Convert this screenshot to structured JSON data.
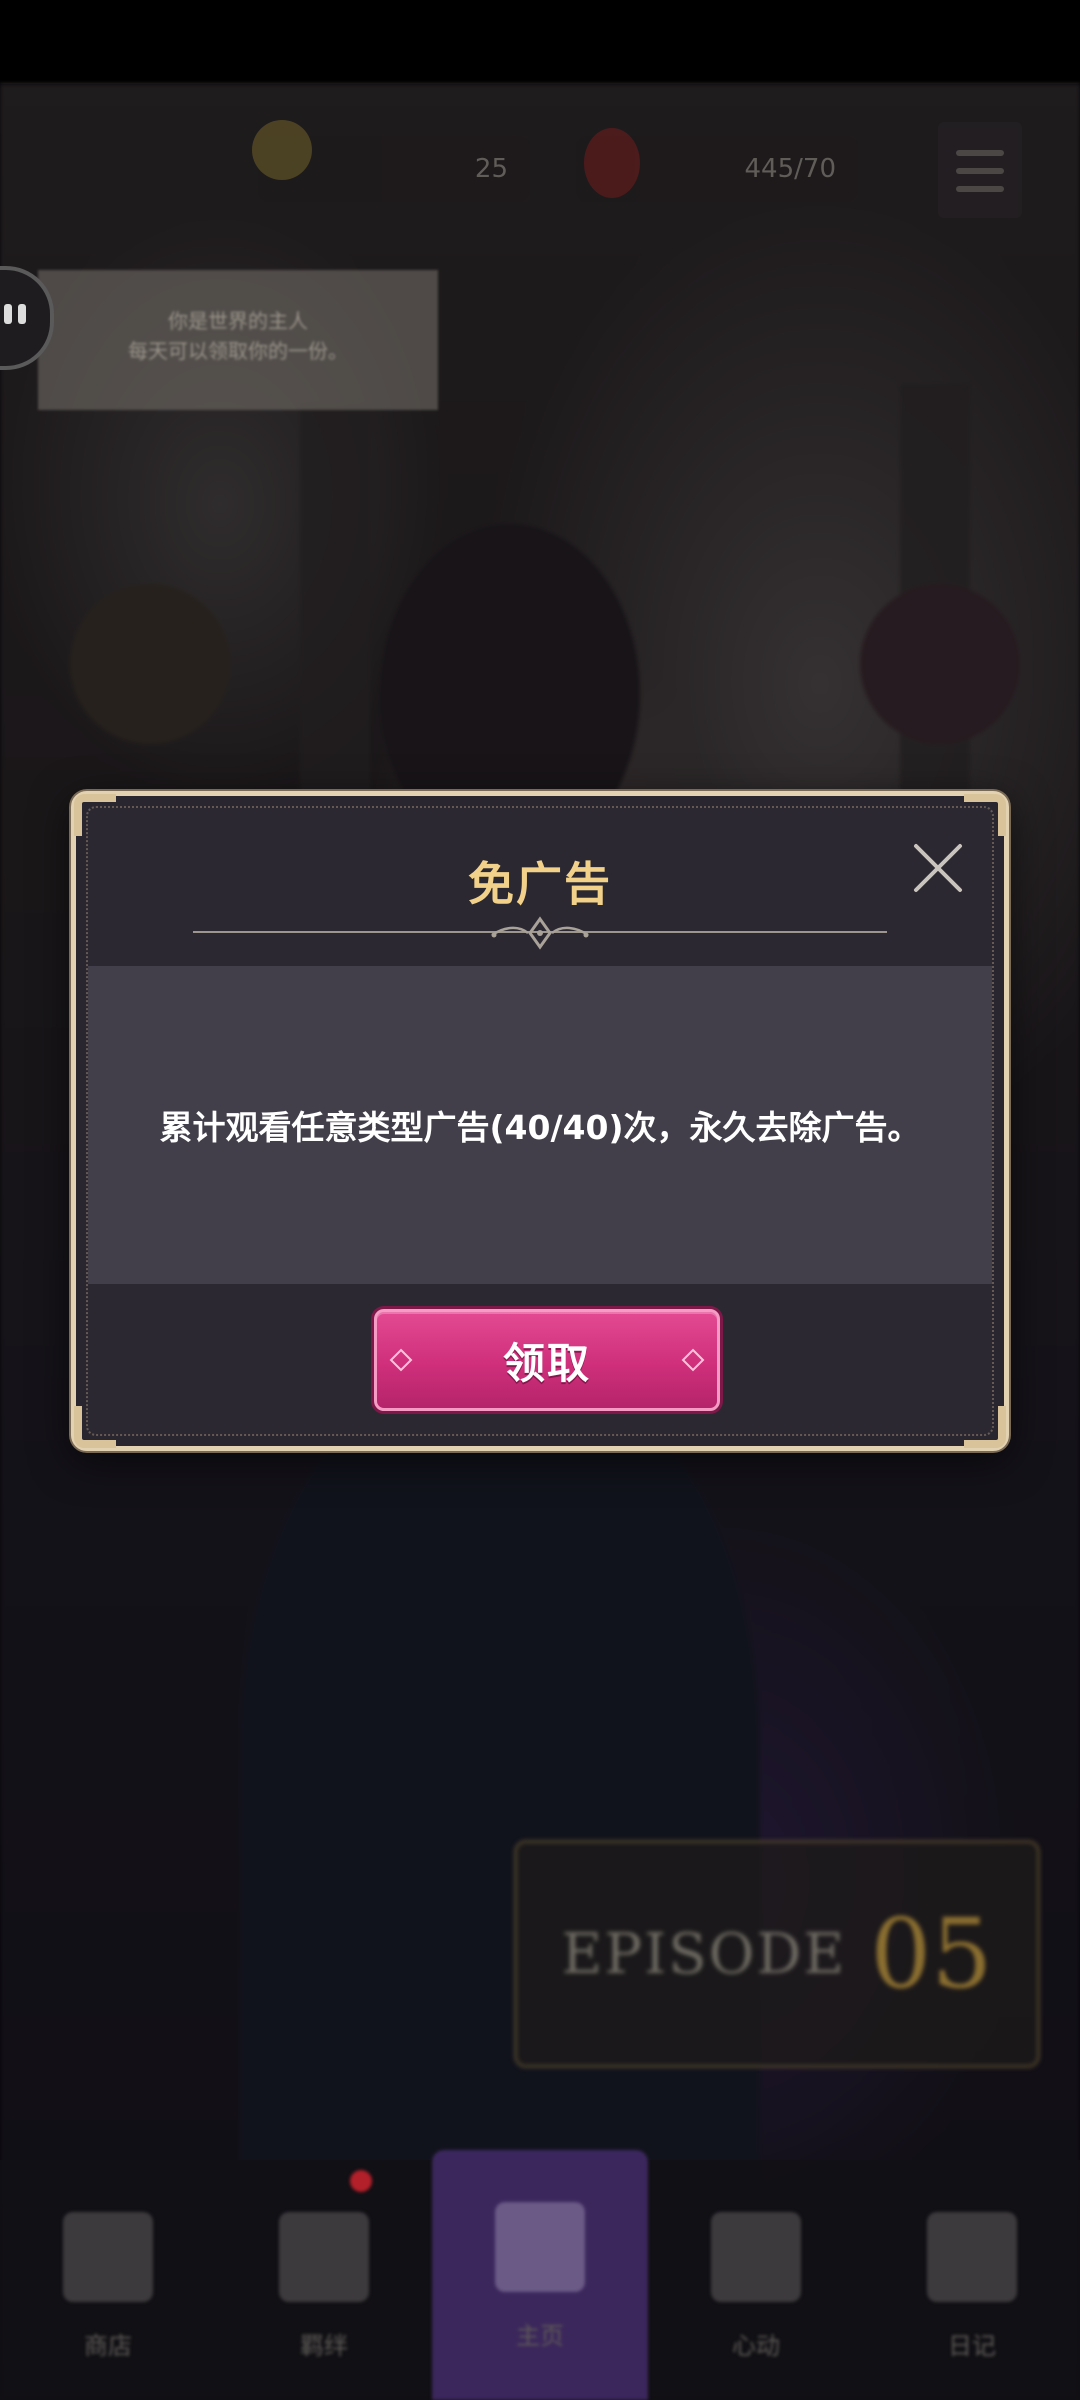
{
  "modal": {
    "title": "免广告",
    "message": "累计观看任意类型广告(40/40)次，永久去除广告。",
    "claim_button_label": "领取",
    "close_icon": "close-x-icon"
  },
  "colors": {
    "title": "#f2d28a",
    "claim_button": "#d63580",
    "modal_bg": "#2a2630",
    "modal_body_bg": "#423e4a",
    "frame": "#e3d2b2"
  },
  "background": {
    "hud_currency_1": "25",
    "hud_currency_2": "445/70",
    "notice_text": "你是世界的主人\n每天可以领取你的一份。",
    "episode_word": "EPISODE",
    "episode_number": "05",
    "bottom_nav": [
      {
        "label": "商店",
        "icon": "shop-icon",
        "badge": false
      },
      {
        "label": "羁绊",
        "icon": "heart-card-icon",
        "badge": true
      },
      {
        "label": "主页",
        "icon": "castle-icon",
        "badge": false,
        "active": true
      },
      {
        "label": "心动",
        "icon": "heart-icon",
        "badge": false
      },
      {
        "label": "日记",
        "icon": "notebook-icon",
        "badge": false
      }
    ]
  }
}
